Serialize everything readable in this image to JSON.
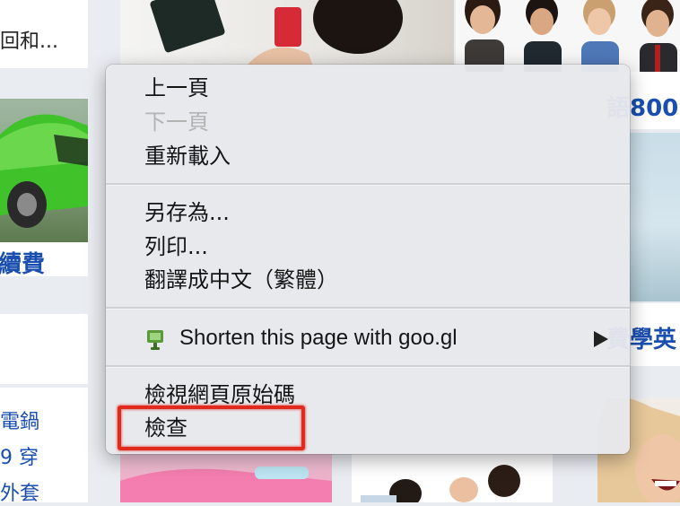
{
  "background": {
    "top_left_snippet": "回和...",
    "car_caption": "續費",
    "right_snippet_1": "語800",
    "right_snippet_2": "費學英",
    "left_links": [
      "電鍋",
      "9 穿",
      "外套"
    ]
  },
  "context_menu": {
    "items": [
      {
        "label": "上一頁",
        "enabled": true
      },
      {
        "label": "下一頁",
        "enabled": false
      },
      {
        "label": "重新載入",
        "enabled": true
      },
      {
        "label": "另存為...",
        "enabled": true
      },
      {
        "label": "列印...",
        "enabled": true
      },
      {
        "label": "翻譯成中文（繁體）",
        "enabled": true
      },
      {
        "label": "Shorten this page with goo.gl",
        "enabled": true,
        "icon": "goo-gl-extension-icon",
        "has_submenu": true
      },
      {
        "label": "檢視網頁原始碼",
        "enabled": true
      },
      {
        "label": "檢查",
        "enabled": true,
        "highlighted": true
      }
    ]
  },
  "colors": {
    "highlight_box": "#e02a1e",
    "link_blue": "#1a4fb0",
    "car_green": "#3fc22a"
  }
}
